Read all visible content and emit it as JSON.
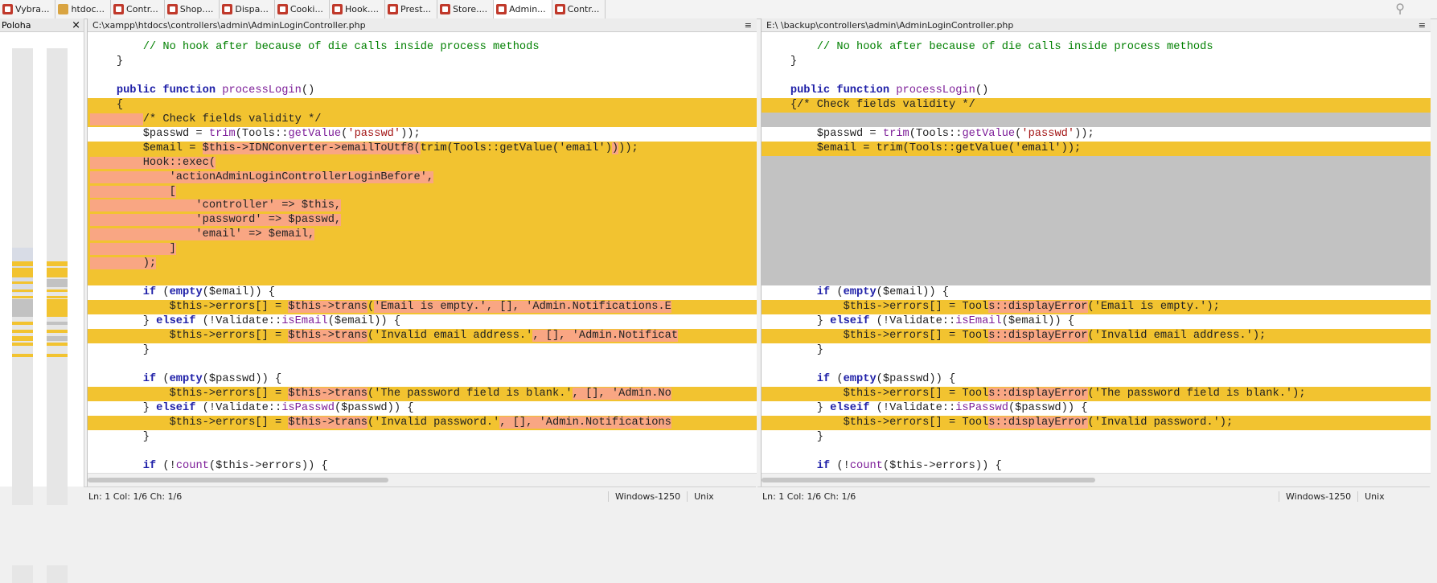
{
  "tabs": [
    {
      "label": "Vybra...",
      "icon": "php-file-icon"
    },
    {
      "label": "htdoc...",
      "icon": "folder-icon"
    },
    {
      "label": "Contr...",
      "icon": "php-file-icon"
    },
    {
      "label": "Shop....",
      "icon": "php-file-icon"
    },
    {
      "label": "Dispa...",
      "icon": "php-file-icon"
    },
    {
      "label": "Cooki...",
      "icon": "php-file-icon"
    },
    {
      "label": "Hook....",
      "icon": "php-file-icon"
    },
    {
      "label": "Prest...",
      "icon": "php-file-icon"
    },
    {
      "label": "Store....",
      "icon": "php-file-icon"
    },
    {
      "label": "Admin...",
      "icon": "php-file-icon",
      "active": true
    },
    {
      "label": "Contr...",
      "icon": "php-file-icon"
    }
  ],
  "location": {
    "title": "Poloha",
    "close": "×"
  },
  "left_pane": {
    "path": "C:\\xampp\\htdocs\\controllers\\admin\\AdminLoginController.php",
    "menu": "≡"
  },
  "right_pane": {
    "path": "E:\\          \\backup\\controllers\\admin\\AdminLoginController.php",
    "menu": "≡"
  },
  "status_left": {
    "position": "Ln: 1  Col: 1/6  Ch: 1/6",
    "encoding": "Windows-1250",
    "eol": "Unix"
  },
  "status_right": {
    "position": "Ln: 1  Col: 1/6  Ch: 1/6",
    "encoding": "Windows-1250",
    "eol": "Unix"
  },
  "colors": {
    "changed": "#f2c330",
    "inline_diff": "#f9a683",
    "missing": "#c2c2c2"
  }
}
